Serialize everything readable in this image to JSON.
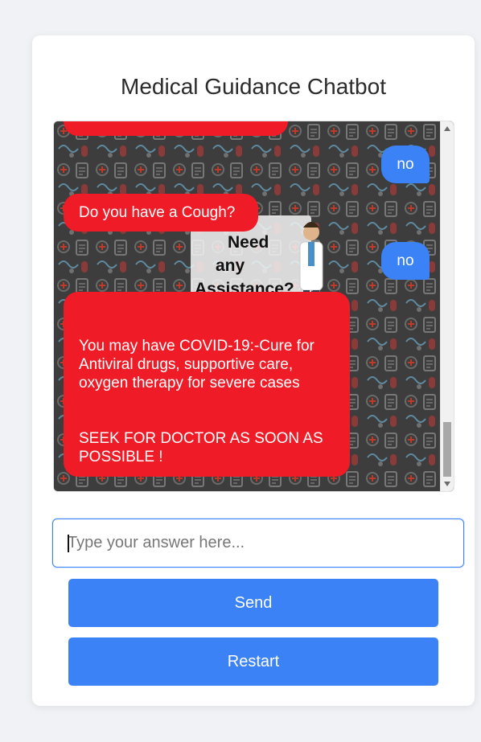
{
  "app": {
    "title": "Medical Guidance Chatbot"
  },
  "chat": {
    "background_poster": {
      "line1": "Need",
      "line2": "any",
      "line3": "Assistance?"
    },
    "messages": [
      {
        "sender": "bot",
        "text": ""
      },
      {
        "sender": "user",
        "text": "no"
      },
      {
        "sender": "bot",
        "text": "Do you have a Cough?"
      },
      {
        "sender": "user",
        "text": "no"
      },
      {
        "sender": "bot",
        "paragraph1": "You may have COVID-19:-Cure for Antiviral drugs, supportive care, oxygen therapy for severe cases",
        "paragraph2": "SEEK FOR DOCTOR AS SOON AS POSSIBLE !"
      }
    ]
  },
  "input": {
    "placeholder": "Type your answer here...",
    "value": ""
  },
  "buttons": {
    "send_label": "Send",
    "restart_label": "Restart"
  },
  "colors": {
    "bot_bubble": "#ef1c27",
    "user_bubble": "#3b82f6",
    "button": "#3b82f6",
    "page_background": "#f0f2f5"
  },
  "icons": [
    "scroll-up-arrow-icon",
    "scroll-down-arrow-icon",
    "doctor-illustration-icon"
  ]
}
